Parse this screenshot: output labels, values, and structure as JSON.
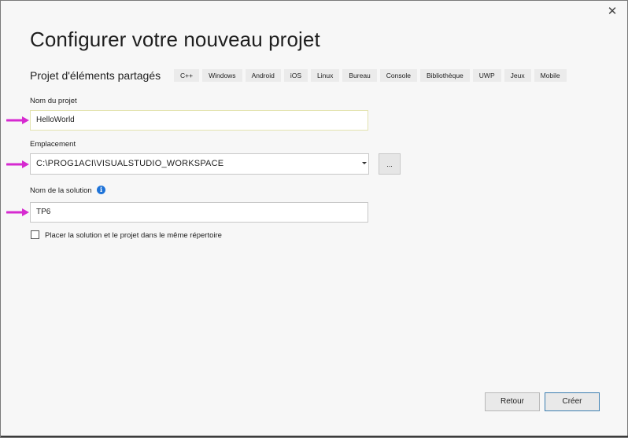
{
  "dialog": {
    "title": "Configurer votre nouveau projet",
    "close_glyph": "✕"
  },
  "template": {
    "name": "Projet d'éléments partagés",
    "tags": [
      "C++",
      "Windows",
      "Android",
      "iOS",
      "Linux",
      "Bureau",
      "Console",
      "Bibliothèque",
      "UWP",
      "Jeux",
      "Mobile"
    ]
  },
  "fields": {
    "project_name_label": "Nom du projet",
    "project_name_value": "HelloWorld",
    "location_label": "Emplacement",
    "location_value": "C:\\PROG1ACI\\VISUALSTUDIO_WORKSPACE",
    "browse_label": "...",
    "solution_name_label": "Nom de la solution",
    "solution_name_value": "TP6",
    "same_dir_label": "Placer la solution et le projet dans le même répertoire",
    "same_dir_checked": false
  },
  "buttons": {
    "back_label": "Retour",
    "create_label": "Créer"
  },
  "annotations": {
    "arrow_color": "#d62ad0",
    "arrow_icon": "right-arrow-icon"
  },
  "colors": {
    "info_icon": "#1e73d8",
    "primary_button_border": "#3c7fb1"
  }
}
